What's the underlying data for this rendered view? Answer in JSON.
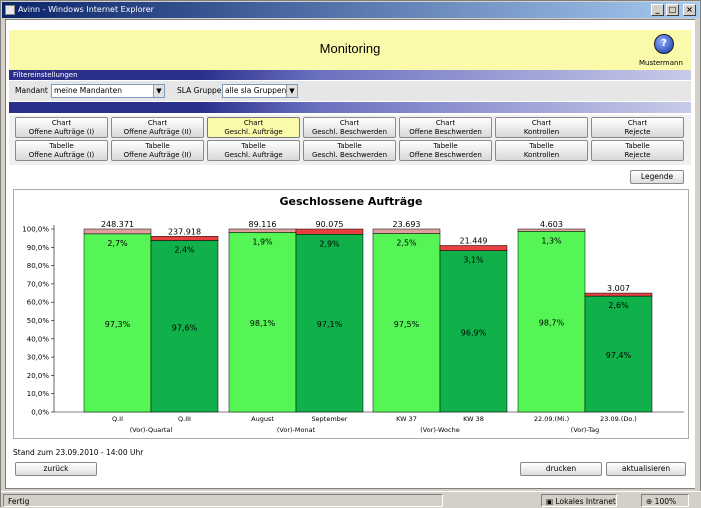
{
  "window": {
    "title": "Avinn - Windows Internet Explorer"
  },
  "header": {
    "title": "Monitoring",
    "user": "Mustermann"
  },
  "filterbar": {
    "label": "Filtereinstellungen"
  },
  "filters": {
    "mandant_label": "Mandant",
    "mandant_value": "meine Mandanten",
    "sla_label": "SLA Gruppe",
    "sla_value": "alle sla Gruppen"
  },
  "nav": {
    "row1": [
      {
        "line1": "Chart",
        "line2": "Offene Aufträge (I)"
      },
      {
        "line1": "Chart",
        "line2": "Offene Aufträge (II)"
      },
      {
        "line1": "Chart",
        "line2": "Geschl. Aufträge"
      },
      {
        "line1": "Chart",
        "line2": "Geschl. Beschwerden"
      },
      {
        "line1": "Chart",
        "line2": "Offene Beschwerden"
      },
      {
        "line1": "Chart",
        "line2": "Kontrollen"
      },
      {
        "line1": "Chart",
        "line2": "Rejecte"
      }
    ],
    "row2": [
      {
        "line1": "Tabelle",
        "line2": "Offene Aufträge (I)"
      },
      {
        "line1": "Tabelle",
        "line2": "Offene Aufträge (II)"
      },
      {
        "line1": "Tabelle",
        "line2": "Geschl. Aufträge"
      },
      {
        "line1": "Tabelle",
        "line2": "Geschl. Beschwerden"
      },
      {
        "line1": "Tabelle",
        "line2": "Offene Beschwerden"
      },
      {
        "line1": "Tabelle",
        "line2": "Kontrollen"
      },
      {
        "line1": "Tabelle",
        "line2": "Rejecte"
      }
    ]
  },
  "legend_label": "Legende",
  "stand": "Stand zum 23.09.2010 - 14:00 Uhr",
  "footer": {
    "back": "zurück",
    "print": "drucken",
    "refresh": "aktualisieren"
  },
  "statusbar": {
    "left": "Fertig",
    "zone": "Lokales Intranet",
    "zoom": "100%"
  },
  "colors": {
    "green_light": "#55f555",
    "green_dark": "#10b04a",
    "red": "#e84040",
    "red_light": "#e0a0a0"
  },
  "chart_data": {
    "type": "bar",
    "title": "Geschlossene Aufträge",
    "ylim": [
      0,
      100
    ],
    "yticks": [
      "0,0%",
      "10,0%",
      "20,0%",
      "30,0%",
      "40,0%",
      "50,0%",
      "60,0%",
      "70,0%",
      "80,0%",
      "90,0%",
      "100,0%"
    ],
    "groups": [
      "(Vor)-Quartal",
      "(Vor)-Monat",
      "(Vor)-Woche",
      "(Vor)-Tag"
    ],
    "categories": [
      "Q.II",
      "Q.III",
      "August",
      "September",
      "KW 37",
      "KW 38",
      "22.09.(Mi.)",
      "23.09.(Do.)"
    ],
    "totals": [
      "248.371",
      "237.918",
      "89.116",
      "90.075",
      "23.693",
      "21.449",
      "4.603",
      "3.007"
    ],
    "bar_heights": [
      100,
      96,
      100,
      100,
      100,
      91,
      100,
      65
    ],
    "series": [
      {
        "values": [
          97.3,
          97.6,
          98.1,
          97.1,
          97.5,
          96.9,
          98.7,
          97.4
        ],
        "labels": [
          "97,3%",
          "97,6%",
          "98,1%",
          "97,1%",
          "97,5%",
          "96,9%",
          "98,7%",
          "97,4%"
        ]
      },
      {
        "values": [
          2.7,
          2.4,
          1.9,
          2.9,
          2.5,
          3.1,
          1.3,
          2.6
        ],
        "labels": [
          "2,7%",
          "2,4%",
          "1,9%",
          "2,9%",
          "2,5%",
          "3,1%",
          "1,3%",
          "2,6%"
        ]
      }
    ]
  }
}
